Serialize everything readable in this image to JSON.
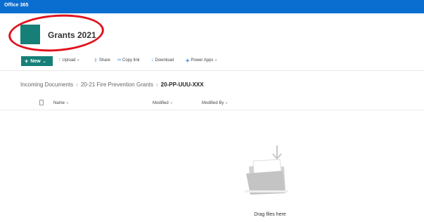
{
  "suitebar": {
    "brand": "Office 365"
  },
  "site": {
    "title": "Grants 2021"
  },
  "command_bar": {
    "new_label": "New",
    "upload_label": "Upload",
    "share_label": "Share",
    "copy_link_label": "Copy link",
    "download_label": "Download",
    "power_apps_label": "Power Apps"
  },
  "breadcrumb": {
    "items": [
      "Incoming Documents",
      "20-21 Fire Prevention Grants"
    ],
    "current": "20-PP-UUU-XXX"
  },
  "list": {
    "columns": [
      "Name",
      "Modified",
      "Modified By"
    ]
  },
  "empty_state": {
    "message": "Drag files here"
  },
  "colors": {
    "suitebar": "#0a6ed1",
    "site_accent": "#168078",
    "annotation_ring": "#e0121c"
  }
}
